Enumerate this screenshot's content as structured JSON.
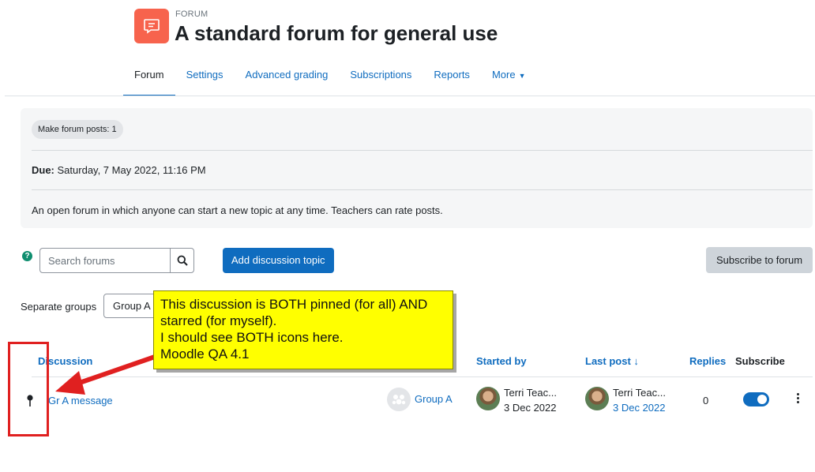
{
  "header": {
    "kicker": "FORUM",
    "title": "A standard forum for general use",
    "icon": "forum-icon"
  },
  "nav": {
    "tabs": [
      {
        "label": "Forum",
        "active": true
      },
      {
        "label": "Settings"
      },
      {
        "label": "Advanced grading"
      },
      {
        "label": "Subscriptions"
      },
      {
        "label": "Reports"
      },
      {
        "label": "More"
      }
    ]
  },
  "info": {
    "pill": "Make forum posts: 1",
    "due_label": "Due:",
    "due_value": "Saturday, 7 May 2022, 11:16 PM",
    "description": "An open forum in which anyone can start a new topic at any time. Teachers can rate posts."
  },
  "toolbar": {
    "search_placeholder": "Search forums",
    "add_label": "Add discussion topic",
    "subscribe_label": "Subscribe to forum"
  },
  "groups": {
    "label": "Separate groups",
    "selected": "Group A"
  },
  "table": {
    "headers": {
      "discussion": "Discussion",
      "started_by": "Started by",
      "last_post": "Last post",
      "replies": "Replies",
      "subscribe": "Subscribe"
    },
    "rows": [
      {
        "topic": "Gr A message",
        "group": "Group A",
        "started_name": "Terri Teac...",
        "started_date": "3 Dec 2022",
        "last_name": "Terri Teac...",
        "last_date": "3 Dec 2022",
        "replies": "0",
        "subscribed": true,
        "pinned": true
      }
    ]
  },
  "annotation": {
    "lines": [
      "This discussion is BOTH pinned (for all) AND",
      "starred (for myself).",
      "I should see BOTH icons here.",
      "Moodle QA 4.1"
    ],
    "colors": {
      "box": "#e02020",
      "callout": "#ffff00"
    }
  },
  "colors": {
    "primary": "#0f6cbf",
    "forum_icon": "#f7634d"
  }
}
